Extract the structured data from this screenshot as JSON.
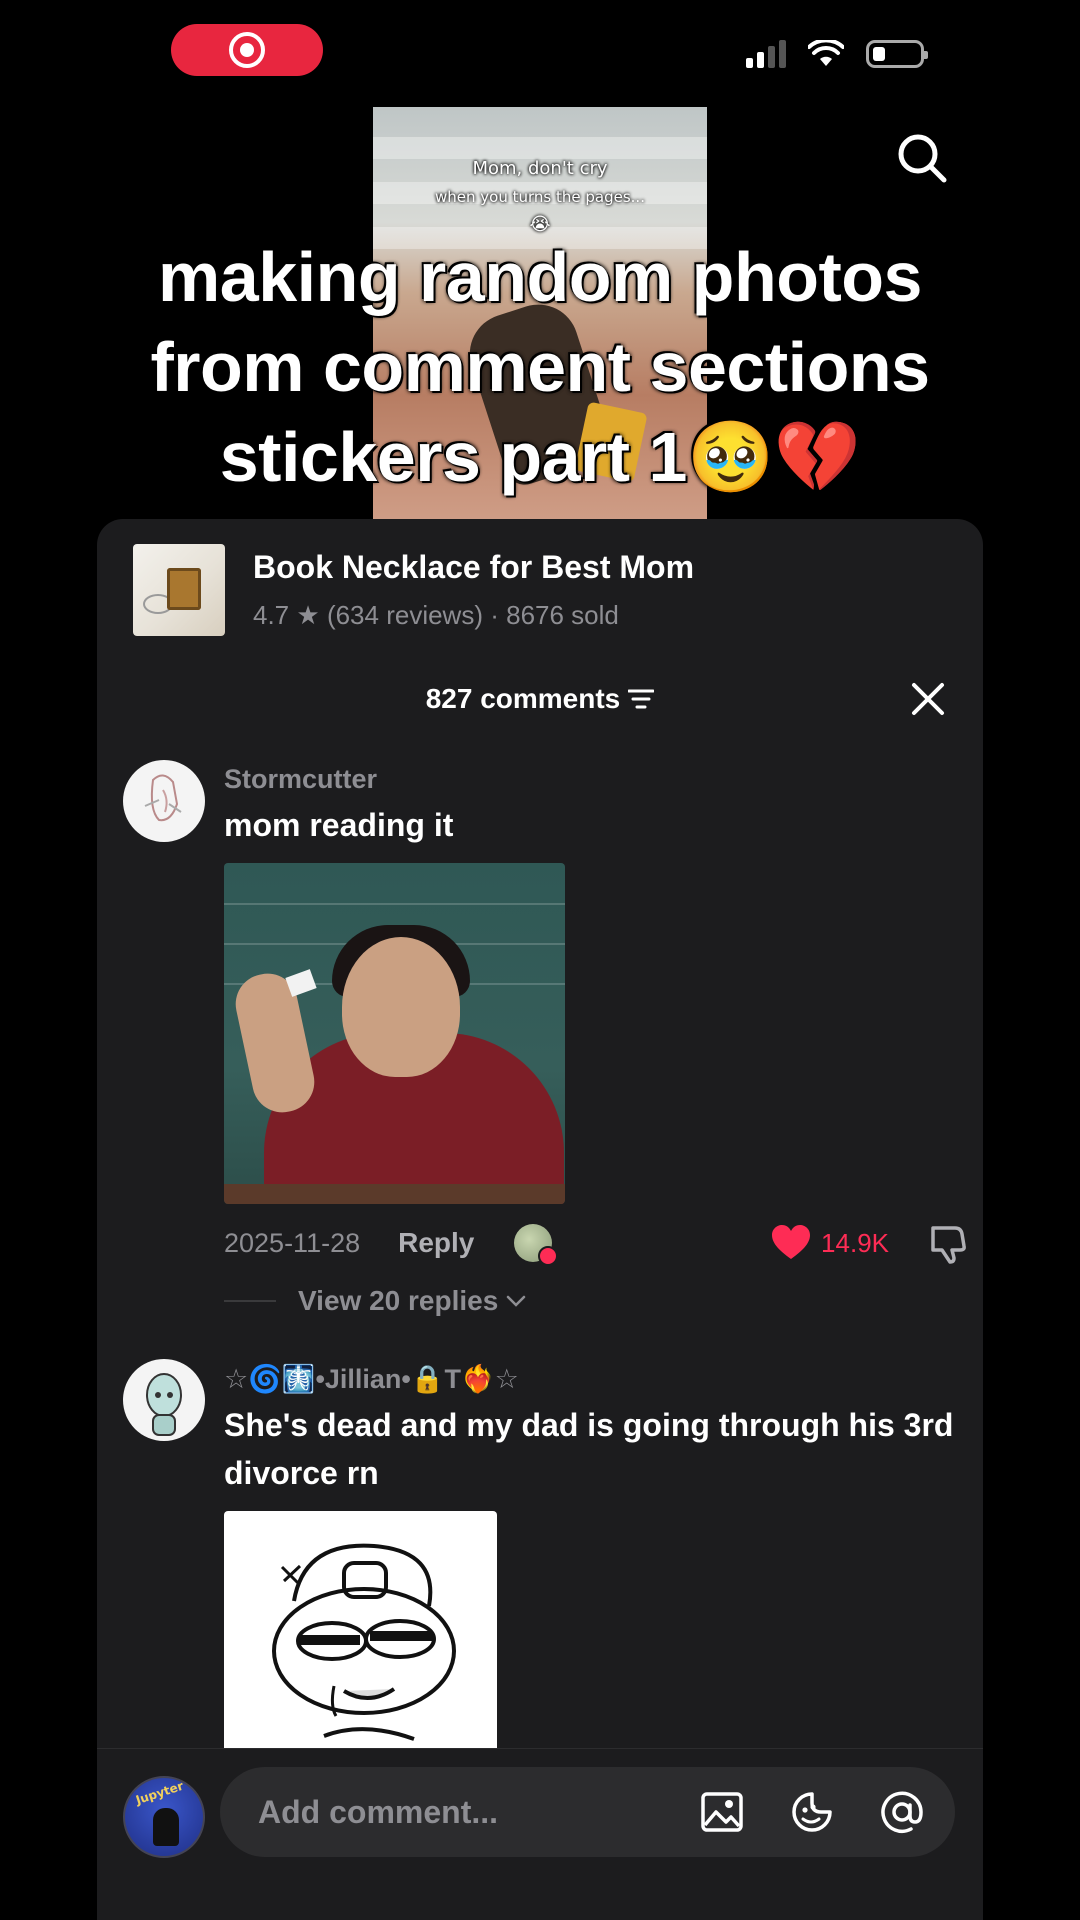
{
  "video": {
    "overlay_line1": "Mom, don't cry",
    "overlay_line2": "when you turns the pages...",
    "overlay_emoji": "😭",
    "caption_line1": "making random photos",
    "caption_line2": "from comment sections",
    "caption_line3": "stickers part 1🥹💔"
  },
  "product": {
    "title": "Book Necklace for Best Mom",
    "rating": "4.7",
    "reviews": "(634 reviews)",
    "sold": "· 8676 sold"
  },
  "comments_header": {
    "count_label": "827 comments"
  },
  "comments": [
    {
      "user": "Stormcutter",
      "text": "mom reading it",
      "date": "2025-11-28",
      "reply_label": "Reply",
      "likes": "14.9K",
      "view_replies": "View 20 replies"
    },
    {
      "user": "☆🌀🩻•Jillian•🔒T❤️‍🔥☆",
      "text": "She's dead and my dad is going through his 3rd divorce rn"
    }
  ],
  "composer": {
    "placeholder": "Add comment..."
  },
  "colors": {
    "accent": "#fe2c55",
    "sheet_bg": "#1c1c1e",
    "record_pill": "#e8263f"
  },
  "icons": [
    "record-icon",
    "signal-icon",
    "wifi-icon",
    "battery-icon",
    "search-icon",
    "sort-icon",
    "close-icon",
    "heart-icon",
    "dislike-icon",
    "chevron-down-icon",
    "image-icon",
    "emoji-icon",
    "mention-icon"
  ]
}
